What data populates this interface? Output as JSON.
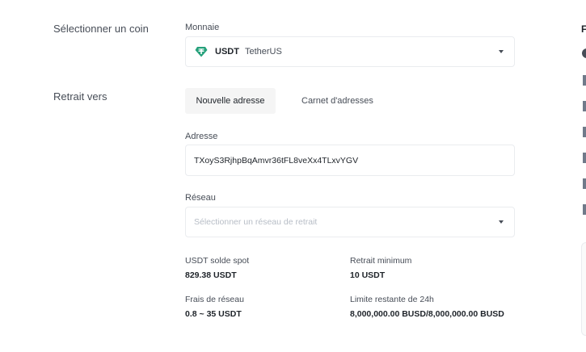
{
  "steps": {
    "select_coin": "Sélectionner un coin",
    "withdraw_to": "Retrait vers"
  },
  "currency": {
    "label": "Monnaie",
    "symbol": "USDT",
    "name": "TetherUS",
    "icon": "usdt-icon",
    "icon_color": "#26a17b"
  },
  "tabs": {
    "new_address": "Nouvelle adresse",
    "address_book": "Carnet d'adresses"
  },
  "address": {
    "label": "Adresse",
    "value": "TXoyS3RjhpBqAmvr36tFL8veXx4TLxvYGV"
  },
  "network": {
    "label": "Réseau",
    "placeholder": "Sélectionner un réseau de retrait"
  },
  "info": {
    "spot_balance_label": "USDT solde spot",
    "spot_balance_value": "829.38 USDT",
    "min_withdraw_label": "Retrait minimum",
    "min_withdraw_value": "10 USDT",
    "network_fee_label": "Frais de réseau",
    "network_fee_value": "0.8 ~ 35 USDT",
    "limit_label": "Limite restante de 24h",
    "limit_value": "8,000,000.00 BUSD/8,000,000.00 BUSD"
  },
  "side_panel": {
    "heading": "F"
  }
}
